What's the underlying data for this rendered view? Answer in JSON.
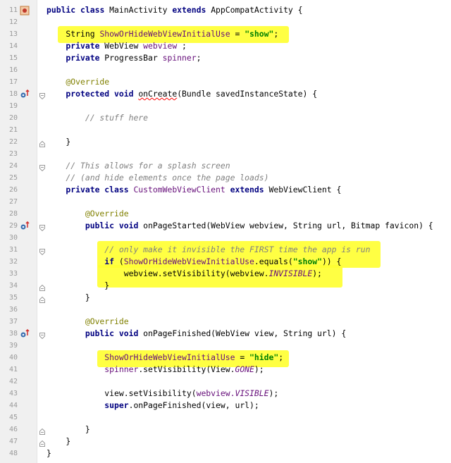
{
  "editor": {
    "lines": [
      {
        "n": "11",
        "icon": "class",
        "fold": "",
        "tokens": [
          {
            "t": "public ",
            "c": "kw"
          },
          {
            "t": "class ",
            "c": "kw"
          },
          {
            "t": "MainActivity ",
            "c": ""
          },
          {
            "t": "extends ",
            "c": "kw"
          },
          {
            "t": "AppCompatActivity {",
            "c": ""
          }
        ]
      },
      {
        "n": "12",
        "tokens": []
      },
      {
        "n": "13",
        "tokens": [
          {
            "t": "    String ",
            "c": ""
          },
          {
            "t": "ShowOrHideWebViewInitialUse",
            "c": "fld"
          },
          {
            "t": " = ",
            "c": ""
          },
          {
            "t": "\"show\"",
            "c": "str"
          },
          {
            "t": ";",
            "c": ""
          }
        ]
      },
      {
        "n": "14",
        "tokens": [
          {
            "t": "    private ",
            "c": "kw"
          },
          {
            "t": "WebView ",
            "c": ""
          },
          {
            "t": "webview",
            "c": "fld"
          },
          {
            "t": " ;",
            "c": ""
          }
        ]
      },
      {
        "n": "15",
        "tokens": [
          {
            "t": "    private ",
            "c": "kw"
          },
          {
            "t": "ProgressBar ",
            "c": ""
          },
          {
            "t": "spinner",
            "c": "fld"
          },
          {
            "t": ";",
            "c": ""
          }
        ]
      },
      {
        "n": "16",
        "tokens": []
      },
      {
        "n": "17",
        "tokens": [
          {
            "t": "    @Override",
            "c": "ann"
          }
        ]
      },
      {
        "n": "18",
        "icon": "override",
        "fold": "open",
        "tokens": [
          {
            "t": "    protected ",
            "c": "kw"
          },
          {
            "t": "void ",
            "c": "kw"
          },
          {
            "t": "onCreate",
            "c": "squig"
          },
          {
            "t": "(Bundle savedInstanceState) {",
            "c": ""
          }
        ]
      },
      {
        "n": "19",
        "tokens": []
      },
      {
        "n": "20",
        "tokens": [
          {
            "t": "        // stuff here",
            "c": "cmt"
          }
        ]
      },
      {
        "n": "21",
        "tokens": []
      },
      {
        "n": "22",
        "fold": "close",
        "tokens": [
          {
            "t": "    }",
            "c": ""
          }
        ]
      },
      {
        "n": "23",
        "tokens": []
      },
      {
        "n": "24",
        "fold": "open",
        "tokens": [
          {
            "t": "    // This allows for a splash screen",
            "c": "cmt"
          }
        ]
      },
      {
        "n": "25",
        "tokens": [
          {
            "t": "    // (and hide elements once the page loads)",
            "c": "cmt"
          }
        ]
      },
      {
        "n": "26",
        "tokens": [
          {
            "t": "    private ",
            "c": "kw"
          },
          {
            "t": "class ",
            "c": "kw"
          },
          {
            "t": "CustomWebViewClient ",
            "c": "fld"
          },
          {
            "t": "extends ",
            "c": "kw"
          },
          {
            "t": "WebViewClient {",
            "c": ""
          }
        ]
      },
      {
        "n": "27",
        "tokens": []
      },
      {
        "n": "28",
        "tokens": [
          {
            "t": "        @Override",
            "c": "ann"
          }
        ]
      },
      {
        "n": "29",
        "icon": "override",
        "fold": "open",
        "tokens": [
          {
            "t": "        public ",
            "c": "kw"
          },
          {
            "t": "void ",
            "c": "kw"
          },
          {
            "t": "onPageStarted(WebView webview, String url, Bitmap favicon) {",
            "c": ""
          }
        ]
      },
      {
        "n": "30",
        "tokens": []
      },
      {
        "n": "31",
        "fold": "open",
        "tokens": [
          {
            "t": "            // only make it invisible the FIRST time the app is run",
            "c": "cmt"
          }
        ]
      },
      {
        "n": "32",
        "tokens": [
          {
            "t": "            if ",
            "c": "kw"
          },
          {
            "t": "(",
            "c": ""
          },
          {
            "t": "ShowOrHideWebViewInitialUse",
            "c": "fld"
          },
          {
            "t": ".equals(",
            "c": ""
          },
          {
            "t": "\"show\"",
            "c": "str"
          },
          {
            "t": ")) {",
            "c": ""
          }
        ]
      },
      {
        "n": "33",
        "tokens": [
          {
            "t": "                webview.setVisibility(webview.",
            "c": ""
          },
          {
            "t": "INVISIBLE",
            "c": "const"
          },
          {
            "t": ");",
            "c": ""
          }
        ]
      },
      {
        "n": "34",
        "fold": "close",
        "tokens": [
          {
            "t": "            }",
            "c": ""
          }
        ]
      },
      {
        "n": "35",
        "fold": "close",
        "tokens": [
          {
            "t": "        }",
            "c": ""
          }
        ]
      },
      {
        "n": "36",
        "tokens": []
      },
      {
        "n": "37",
        "tokens": [
          {
            "t": "        @Override",
            "c": "ann"
          }
        ]
      },
      {
        "n": "38",
        "icon": "override",
        "fold": "open",
        "tokens": [
          {
            "t": "        public ",
            "c": "kw"
          },
          {
            "t": "void ",
            "c": "kw"
          },
          {
            "t": "onPageFinished(WebView view, String url) {",
            "c": ""
          }
        ]
      },
      {
        "n": "39",
        "tokens": []
      },
      {
        "n": "40",
        "tokens": [
          {
            "t": "            ",
            "c": ""
          },
          {
            "t": "ShowOrHideWebViewInitialUse",
            "c": "fld"
          },
          {
            "t": " = ",
            "c": ""
          },
          {
            "t": "\"hide\"",
            "c": "str"
          },
          {
            "t": ";",
            "c": ""
          }
        ]
      },
      {
        "n": "41",
        "tokens": [
          {
            "t": "            ",
            "c": ""
          },
          {
            "t": "spinner",
            "c": "fld"
          },
          {
            "t": ".setVisibility(View.",
            "c": ""
          },
          {
            "t": "GONE",
            "c": "const"
          },
          {
            "t": ");",
            "c": ""
          }
        ]
      },
      {
        "n": "42",
        "tokens": []
      },
      {
        "n": "43",
        "tokens": [
          {
            "t": "            view.setVisibility(",
            "c": ""
          },
          {
            "t": "webview.",
            "c": "fld"
          },
          {
            "t": "VISIBLE",
            "c": "const"
          },
          {
            "t": ");",
            "c": ""
          }
        ]
      },
      {
        "n": "44",
        "tokens": [
          {
            "t": "            super",
            "c": "kw"
          },
          {
            "t": ".onPageFinished(view, url);",
            "c": ""
          }
        ]
      },
      {
        "n": "45",
        "tokens": []
      },
      {
        "n": "46",
        "fold": "close",
        "tokens": [
          {
            "t": "        }",
            "c": ""
          }
        ]
      },
      {
        "n": "47",
        "fold": "close",
        "tokens": [
          {
            "t": "    }",
            "c": ""
          }
        ]
      },
      {
        "n": "48",
        "tokens": [
          {
            "t": "}",
            "c": ""
          }
        ]
      }
    ]
  },
  "colors": {
    "highlight": "#ffff33",
    "keyword": "#000080",
    "string": "#008000",
    "comment": "#808080",
    "annotation": "#808000",
    "field": "#660e7a"
  }
}
